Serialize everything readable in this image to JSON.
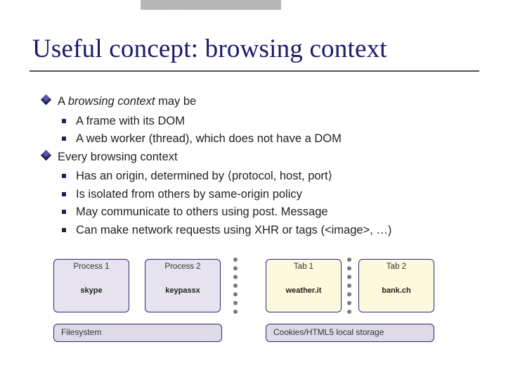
{
  "title": "Useful concept: browsing context",
  "bullets": {
    "l1a_prefix": "A ",
    "l1a_italic": "browsing context",
    "l1a_suffix": "  may be",
    "l1a_sub1": "A frame with its DOM",
    "l1a_sub2": "A web worker (thread), which does not have a DOM",
    "l1b": "Every browsing context",
    "l1b_sub1": "Has an origin, determined by ⟨protocol, host, port⟩",
    "l1b_sub2": "Is isolated from others by same-origin policy",
    "l1b_sub3": "May communicate to others using post. Message",
    "l1b_sub4": "Can make network requests using XHR or tags (<image>, …)"
  },
  "diagram": {
    "proc1_label": "Process 1",
    "proc1_app": "skype",
    "proc2_label": "Process 2",
    "proc2_app": "keypassx",
    "tab1_label": "Tab 1",
    "tab1_app": "weather.it",
    "tab2_label": "Tab 2",
    "tab2_app": "bank.ch",
    "fs_label": "Filesystem",
    "cookies_label": "Cookies/HTML5 local storage"
  }
}
